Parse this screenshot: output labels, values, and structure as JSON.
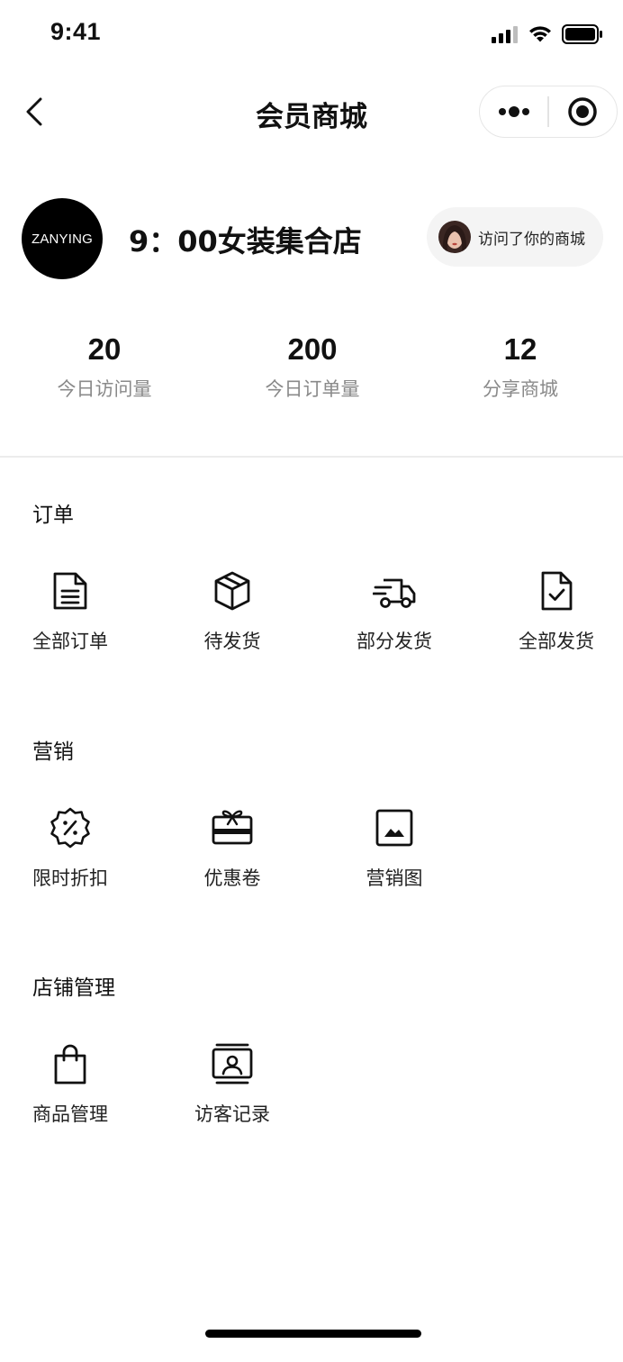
{
  "status_bar": {
    "time": "9:41"
  },
  "nav": {
    "title": "会员商城"
  },
  "shop": {
    "logo_text": "ZANYING",
    "name": "9：00女装集合店",
    "visitor_text": "访问了你的商城"
  },
  "stats": [
    {
      "value": "20",
      "label": "今日访问量"
    },
    {
      "value": "200",
      "label": "今日订单量"
    },
    {
      "value": "12",
      "label": "分享商城"
    }
  ],
  "sections": {
    "orders": {
      "title": "订单",
      "items": [
        {
          "label": "全部订单",
          "icon": "document-icon"
        },
        {
          "label": "待发货",
          "icon": "package-icon"
        },
        {
          "label": "部分发货",
          "icon": "delivery-truck-icon"
        },
        {
          "label": "全部发货",
          "icon": "file-check-icon"
        }
      ]
    },
    "marketing": {
      "title": "营销",
      "items": [
        {
          "label": "限时折扣",
          "icon": "discount-badge-icon"
        },
        {
          "label": "优惠卷",
          "icon": "gift-card-icon"
        },
        {
          "label": "营销图",
          "icon": "image-icon"
        }
      ]
    },
    "store": {
      "title": "店铺管理",
      "items": [
        {
          "label": "商品管理",
          "icon": "shopping-bag-icon"
        },
        {
          "label": "访客记录",
          "icon": "visitor-card-icon"
        }
      ]
    }
  }
}
